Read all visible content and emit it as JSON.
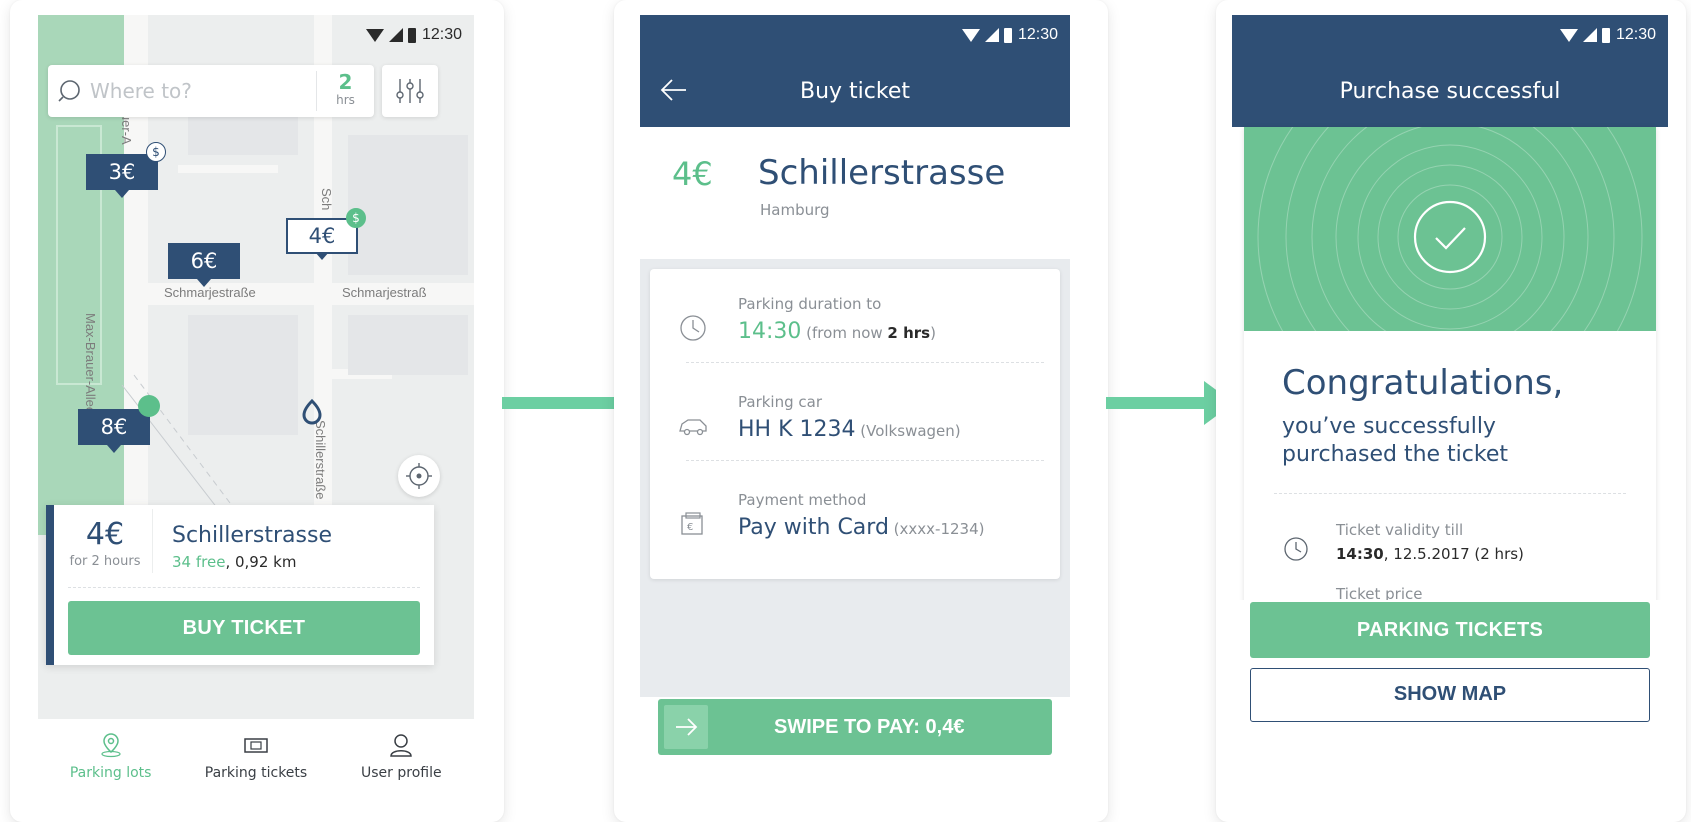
{
  "status": {
    "time": "12:30"
  },
  "screen1": {
    "search": {
      "placeholder": "Where to?",
      "hours_value": "2",
      "hours_unit": "hrs"
    },
    "streets": [
      "Max-Brauer-Allee",
      "Schmarjestraße",
      "Schmarjestraß",
      "Schillerstraße",
      "Bauer-A",
      "Sch"
    ],
    "markers": [
      {
        "label": "3€"
      },
      {
        "label": "6€"
      },
      {
        "label": "4€"
      },
      {
        "label": "8€"
      }
    ],
    "dollar_badge": "$",
    "lot": {
      "price": "4€",
      "duration": "for 2 hours",
      "name": "Schillerstrasse",
      "free": "34 free",
      "distance": ", 0,92 km",
      "buy_label": "BUY TICKET"
    },
    "tabs": [
      {
        "label": "Parking lots",
        "icon": "location-pin-icon",
        "active": true
      },
      {
        "label": "Parking tickets",
        "icon": "ticket-icon",
        "active": false
      },
      {
        "label": "User profile",
        "icon": "user-icon",
        "active": false
      }
    ]
  },
  "screen2": {
    "title": "Buy ticket",
    "price": "4€",
    "name": "Schillerstrasse",
    "city": "Hamburg",
    "rows": [
      {
        "label": "Parking duration to",
        "value": "14:30",
        "note_prefix": " (from now ",
        "note_bold": "2 hrs",
        "note_suffix": ")",
        "icon": "clock-icon"
      },
      {
        "label": "Parking car",
        "value": "HH K 1234",
        "note": " (Volkswagen)",
        "icon": "car-icon"
      },
      {
        "label": "Payment method",
        "value": "Pay with Card",
        "note": "  (xxxx-1234)",
        "icon": "wallet-icon"
      }
    ],
    "swipe_label": "SWIPE TO PAY: 0,4€"
  },
  "screen3": {
    "title": "Purchase successful",
    "congrats": "Congratulations,",
    "subtitle": "you’ve successfully purchased the ticket",
    "validity_label": "Ticket validity till",
    "validity_time": "14:30",
    "validity_rest": ", 12.5.2017 (2 hrs)",
    "price_label": "Ticket price",
    "primary_button": "PARKING TICKETS",
    "secondary_button": "SHOW MAP"
  },
  "colors": {
    "navy": "#2f4f75",
    "green": "#6cc293",
    "accent_green": "#5cbf8b"
  }
}
